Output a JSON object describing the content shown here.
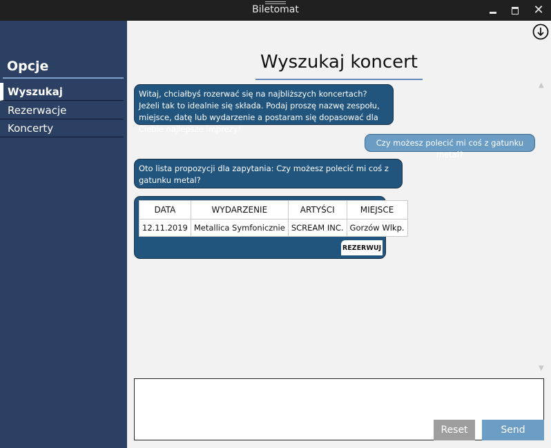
{
  "window": {
    "title": "Biletomat",
    "minimize_label": "",
    "close_label": "✕"
  },
  "sidebar": {
    "title": "Opcje",
    "items": [
      {
        "label": "Wyszukaj",
        "active": true
      },
      {
        "label": "Rezerwacje",
        "active": false
      },
      {
        "label": "Koncerty",
        "active": false
      }
    ]
  },
  "icons": {
    "download": "download-circle-icon",
    "scroll_up": "▲",
    "scroll_down": "▼"
  },
  "main": {
    "title": "Wyszukaj koncert"
  },
  "chat": {
    "messages": [
      {
        "sender": "bot",
        "text": "Witaj, chciałbyś rozerwać się na najbliższych koncertach? Jeżeli tak to idealnie się składa. Podaj proszę nazwę zespołu, miejsce, datę lub wydarzenie a postaram się dopasować dla Ciebie najlepsze imprezy!"
      },
      {
        "sender": "user",
        "text": "Czy możesz polecić mi coś z gatunku metal?"
      },
      {
        "sender": "bot",
        "text": "Oto lista propozycji dla zapytania: Czy możesz polecić mi coś z gatunku metal?"
      }
    ],
    "results": {
      "columns": [
        "DATA",
        "WYDARZENIE",
        "ARTYŚCI",
        "MIEJSCE"
      ],
      "rows": [
        [
          "12.11.2019",
          "Metallica Symfonicznie",
          "SCREAM INC.",
          "Gorzów Wlkp."
        ]
      ],
      "reserve_label": "REZERWUJ"
    }
  },
  "input": {
    "value": "",
    "placeholder": "",
    "reset_label": "Reset",
    "send_label": "Send"
  },
  "colors": {
    "sidebar_bg": "#2c4064",
    "bot_bubble": "#21557d",
    "user_bubble": "#6b9cc4",
    "send_button": "#6c9dc4",
    "reset_button": "#9e9e9e",
    "titlebar": "#202020"
  }
}
